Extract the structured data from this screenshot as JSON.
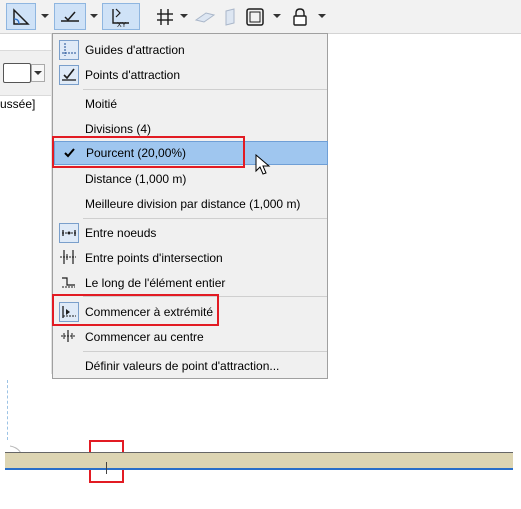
{
  "toolbar": {
    "icons": [
      "angle-tool-icon",
      "snap-guide-icon",
      "xy-coordinate-icon",
      "grid-snap-icon",
      "plane-icon",
      "side-plane-icon",
      "frame-icon",
      "lock-icon"
    ]
  },
  "left_panel": {
    "text": "ussée]"
  },
  "menu": {
    "items": [
      {
        "label": "Guides d'attraction"
      },
      {
        "label": "Points d'attraction"
      },
      {
        "label": "Moitié"
      },
      {
        "label": "Divisions (4)"
      },
      {
        "label": "Pourcent (20,00%)"
      },
      {
        "label": "Distance (1,000 m)"
      },
      {
        "label": "Meilleure division par distance (1,000 m)"
      },
      {
        "label": "Entre noeuds"
      },
      {
        "label": "Entre points d'intersection"
      },
      {
        "label": "Le long de l'élément entier"
      },
      {
        "label": "Commencer à extrémité"
      },
      {
        "label": "Commencer au centre"
      },
      {
        "label": "Définir valeurs de point d'attraction..."
      }
    ],
    "selected": "Pourcent (20,00%)"
  },
  "colors": {
    "highlight": "#9fc6ef",
    "annotation_red": "#e21b23",
    "wall_fill": "#ddd5b3",
    "wall_line": "#2a6fc9"
  }
}
